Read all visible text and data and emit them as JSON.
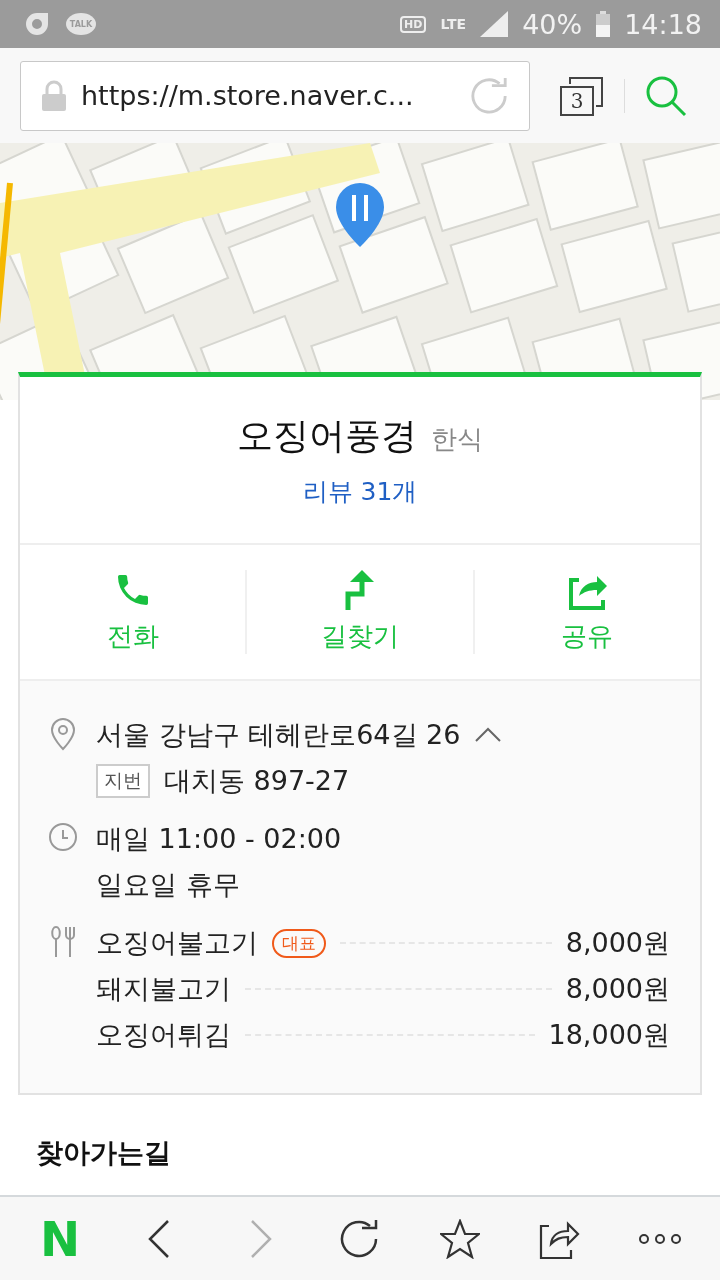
{
  "status_bar": {
    "apps": [
      {
        "kind": "g"
      },
      {
        "kind": "talk",
        "label": "TALK"
      }
    ],
    "hd": "HD",
    "network": "LTE",
    "battery": "40%",
    "time": "14:18"
  },
  "address_bar": {
    "url": "https://m.store.naver.c...",
    "tabs_count": "3"
  },
  "place": {
    "name": "오징어풍경",
    "category": "한식",
    "reviews": "리뷰 31개"
  },
  "actions": [
    {
      "kind": "call",
      "label": "전화"
    },
    {
      "kind": "route",
      "label": "길찾기"
    },
    {
      "kind": "share",
      "label": "공유"
    }
  ],
  "info": {
    "address": "서울 강남구 테헤란로64길 26",
    "expanded": true,
    "lot_tag": "지번",
    "lot_address": "대치동 897-27",
    "hours": "매일 11:00 - 02:00",
    "closed": "일요일 휴무",
    "menu": [
      {
        "name": "오징어불고기",
        "badge": "대표",
        "price": "8,000원"
      },
      {
        "name": "돼지불고기",
        "price": "8,000원"
      },
      {
        "name": "오징어튀김",
        "price": "18,000원"
      }
    ]
  },
  "section_title": "찾아가는길",
  "toolbar": {
    "logo": "N",
    "buttons": [
      {
        "kind": "back",
        "disabled": false
      },
      {
        "kind": "forward",
        "disabled": true
      },
      {
        "kind": "reload",
        "disabled": false
      },
      {
        "kind": "star",
        "disabled": false
      },
      {
        "kind": "share",
        "disabled": false
      },
      {
        "kind": "more",
        "disabled": false
      }
    ]
  }
}
